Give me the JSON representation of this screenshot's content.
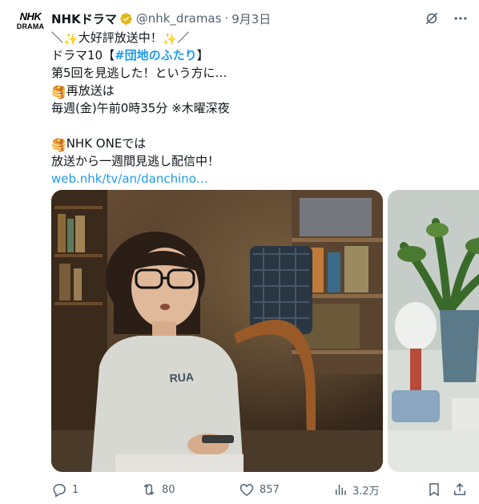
{
  "avatar": {
    "line1": "NHK",
    "line2": "DRAMA"
  },
  "tweet": {
    "author_name": "NHKドラマ",
    "handle": "@nhk_dramas",
    "separator": "·",
    "date": "9月3日",
    "lines": [
      {
        "pre": "＼",
        "emoji1": "✨",
        "mid": "大好評放送中！",
        "emoji2": "✨",
        "post": "／"
      },
      {
        "pre": "ドラマ10【",
        "hashtag": "#団地のふたり",
        "post": "】"
      },
      {
        "text": "第5回を見逃した！という方に…"
      },
      {
        "emoji": "🥞",
        "text": "再放送は"
      },
      {
        "text": "毎週(金)午前0時35分 ※木曜深夜"
      },
      {
        "emoji": "🥞",
        "text": "NHK ONEでは"
      },
      {
        "text": "放送から一週間見逃し配信中！"
      },
      {
        "link": "web.nhk/tv/an/danchino…"
      }
    ]
  },
  "actions": {
    "replies": "1",
    "retweets": "80",
    "likes": "857",
    "views": "3.2万"
  },
  "colors": {
    "link": "#1d9bf0",
    "secondary": "#536471",
    "verified": "#e2b719"
  },
  "icons": [
    "grok-icon",
    "more-icon",
    "reply-icon",
    "retweet-icon",
    "like-icon",
    "views-icon",
    "bookmark-icon",
    "share-icon",
    "verified-badge-icon"
  ]
}
